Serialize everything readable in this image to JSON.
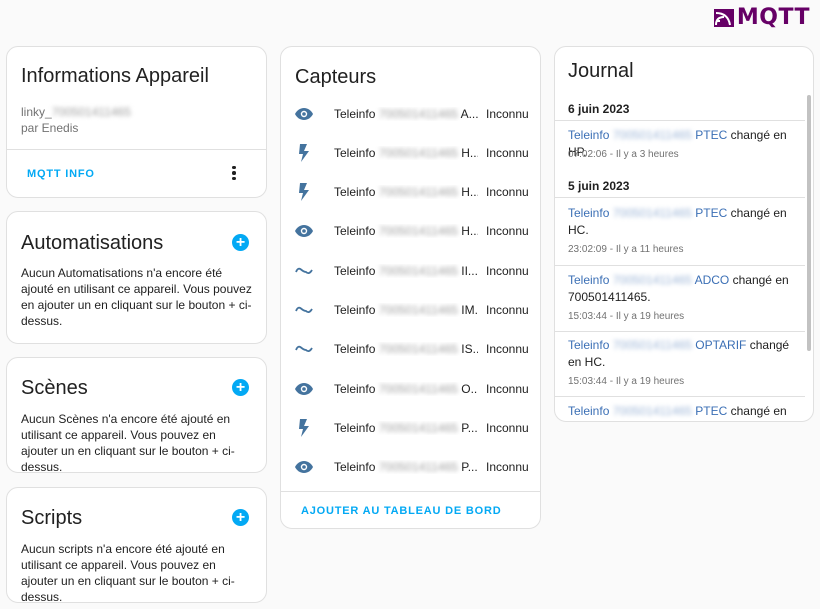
{
  "logo": {
    "text": "MQTT"
  },
  "device": {
    "title": "Informations Appareil",
    "model_prefix": "linky_",
    "model_blur": "700501411465",
    "manufacturer": "par Enedis",
    "mqtt_info_label": "MQTT INFO"
  },
  "automations": {
    "title": "Automatisations",
    "text": "Aucun Automatisations n'a encore été ajouté en utilisant ce appareil. Vous pouvez en ajouter un en cliquant sur le bouton + ci-dessus."
  },
  "scenes": {
    "title": "Scènes",
    "text": "Aucun Scènes n'a encore été ajouté en utilisant ce appareil. Vous pouvez en ajouter un en cliquant sur le bouton + ci-dessus."
  },
  "scripts": {
    "title": "Scripts",
    "text": "Aucun scripts n'a encore été ajouté en utilisant ce appareil. Vous pouvez en ajouter un en cliquant sur le bouton + ci-dessus."
  },
  "sensors": {
    "title": "Capteurs",
    "add_to_dashboard_label": "AJOUTER AU TABLEAU DE BORD",
    "items": [
      {
        "icon": "eye-icon",
        "prefix": "Teleinfo",
        "blur": "700501411465",
        "suffix": "A...",
        "state": "Inconnu"
      },
      {
        "icon": "flash-icon",
        "prefix": "Teleinfo",
        "blur": "700501411465",
        "suffix": "H...",
        "state": "Inconnu"
      },
      {
        "icon": "flash-icon",
        "prefix": "Teleinfo",
        "blur": "700501411465",
        "suffix": "H...",
        "state": "Inconnu"
      },
      {
        "icon": "eye-icon",
        "prefix": "Teleinfo",
        "blur": "700501411465",
        "suffix": "H...",
        "state": "Inconnu"
      },
      {
        "icon": "current-ac-icon",
        "prefix": "Teleinfo",
        "blur": "700501411465",
        "suffix": "II...",
        "state": "Inconnu"
      },
      {
        "icon": "current-ac-icon",
        "prefix": "Teleinfo",
        "blur": "700501411465",
        "suffix": "IM...",
        "state": "Inconnu"
      },
      {
        "icon": "current-ac-icon",
        "prefix": "Teleinfo",
        "blur": "700501411465",
        "suffix": "IS...",
        "state": "Inconnu"
      },
      {
        "icon": "eye-icon",
        "prefix": "Teleinfo",
        "blur": "700501411465",
        "suffix": "O...",
        "state": "Inconnu"
      },
      {
        "icon": "flash-icon",
        "prefix": "Teleinfo",
        "blur": "700501411465",
        "suffix": "P...",
        "state": "Inconnu"
      },
      {
        "icon": "eye-icon",
        "prefix": "Teleinfo",
        "blur": "700501411465",
        "suffix": "P...",
        "state": "Inconnu"
      }
    ]
  },
  "journal": {
    "title": "Journal",
    "date1": "6 juin 2023",
    "date2": "5 juin 2023",
    "entries": [
      {
        "link_prefix": "Teleinfo",
        "blur": "700501411465",
        "entity": "PTEC",
        "text": "changé en HP.",
        "time": "07:02:06 - Il y a 3 heures"
      },
      {
        "link_prefix": "Teleinfo",
        "blur": "700501411465",
        "entity": "PTEC",
        "text": "changé en HC.",
        "time": "23:02:09 - Il y a 11 heures"
      },
      {
        "link_prefix": "Teleinfo",
        "blur": "700501411465",
        "entity": "ADCO",
        "text": "changé en 700501411465.",
        "time": "15:03:44 - Il y a 19 heures"
      },
      {
        "link_prefix": "Teleinfo",
        "blur": "700501411465",
        "entity": "OPTARIF",
        "text": "changé en HC.",
        "time": "15:03:44 - Il y a 19 heures"
      },
      {
        "link_prefix": "Teleinfo",
        "blur": "700501411465",
        "entity": "PTEC",
        "text": "changé en HP.",
        "time": ""
      }
    ]
  },
  "colors": {
    "accent": "#03a9f4",
    "icon": "#44739e",
    "link": "#3b6fb5",
    "mqtt": "#660066"
  }
}
